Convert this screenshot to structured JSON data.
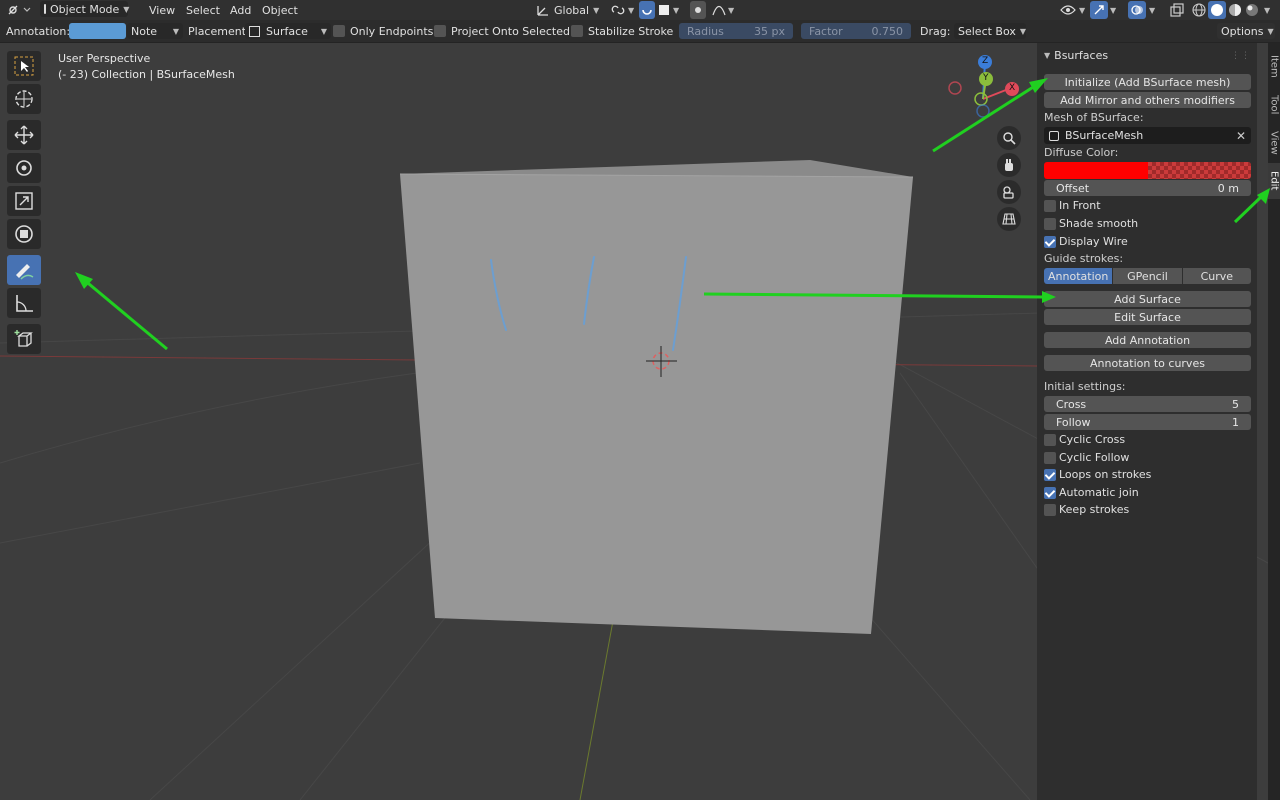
{
  "header": {
    "mode": "Object Mode",
    "menus": [
      "View",
      "Select",
      "Add",
      "Object"
    ],
    "orientation": "Global",
    "options": "Options"
  },
  "toolsettings": {
    "annotation_label": "Annotation:",
    "note": "Note",
    "placement_label": "Placement:",
    "placement": "Surface",
    "only_endpoints": "Only Endpoints",
    "project": "Project Onto Selected",
    "stabilize": "Stabilize Stroke",
    "radius_label": "Radius",
    "radius_value": "35 px",
    "factor_label": "Factor",
    "factor_value": "0.750",
    "drag_label": "Drag:",
    "drag_value": "Select Box",
    "annotation_color": "#5b9bd5"
  },
  "viewport": {
    "perspective": "User Perspective",
    "collection": "(- 23) Collection | BSurfaceMesh",
    "axis_x": "X",
    "axis_y": "Y",
    "axis_z": "Z"
  },
  "panel": {
    "title": "Bsurfaces",
    "init": "Initialize (Add BSurface mesh)",
    "mirror": "Add Mirror and others modifiers",
    "mesh_label": "Mesh of BSurface:",
    "mesh_value": "BSurfaceMesh",
    "diffuse_label": "Diffuse Color:",
    "diffuse_color": "#ff0000",
    "offset_label": "Offset",
    "offset_value": "0 m",
    "in_front": "In Front",
    "shade_smooth": "Shade smooth",
    "display_wire": "Display Wire",
    "guide_label": "Guide strokes:",
    "seg_annotation": "Annotation",
    "seg_gpencil": "GPencil",
    "seg_curve": "Curve",
    "add_surface": "Add Surface",
    "edit_surface": "Edit Surface",
    "add_annotation": "Add Annotation",
    "annotation_to_curves": "Annotation to curves",
    "initial_label": "Initial settings:",
    "cross_label": "Cross",
    "cross_value": "5",
    "follow_label": "Follow",
    "follow_value": "1",
    "cyclic_cross": "Cyclic Cross",
    "cyclic_follow": "Cyclic Follow",
    "loops": "Loops on strokes",
    "auto_join": "Automatic join",
    "keep": "Keep strokes"
  },
  "tabs": {
    "item": "Item",
    "tool": "Tool",
    "view": "View",
    "edit": "Edit"
  },
  "icons": [
    "editor-type-icon",
    "object-mode-icon",
    "transform-orientation-icon",
    "pivot-icon",
    "snap-icon",
    "proportional-icon",
    "visibility-icon",
    "gizmo-icon",
    "overlay-icon",
    "xray-icon",
    "shading-wire-icon",
    "shading-solid-icon",
    "shading-material-icon",
    "shading-render-icon",
    "select-box-icon",
    "cursor-icon",
    "move-icon",
    "rotate-icon",
    "scale-icon",
    "transform-icon",
    "annotate-icon",
    "measure-icon",
    "add-cube-icon",
    "zoom-icon",
    "pan-hand-icon",
    "camera-icon",
    "grid-view-icon",
    "close-icon",
    "collapse-icon"
  ]
}
